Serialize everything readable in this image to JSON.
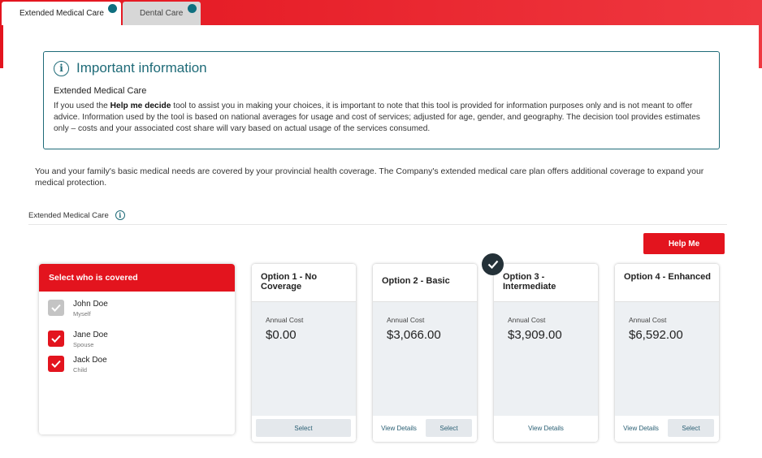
{
  "tabs": [
    {
      "label": "Extended Medical Care"
    },
    {
      "label": "Dental Care"
    }
  ],
  "info": {
    "heading": "Important information",
    "subheading": "Extended Medical Care",
    "body_pre": "If you used the ",
    "body_bold": "Help me decide",
    "body_post": " tool to assist you in making your choices, it is important to note that this tool is provided for information purposes only and is not meant to offer advice. Information used by the tool is based on national averages for usage and cost of services; adjusted for age, gender, and geography. The decision tool provides estimates only – costs and your associated cost share will vary based on actual usage of the services consumed."
  },
  "intro": "You and your family's basic medical needs are covered by your provincial health coverage. The Company's extended medical care plan offers additional coverage to expand your medical protection.",
  "section_label": "Extended Medical Care",
  "help_button": "Help Me",
  "covered": {
    "header": "Select who is covered",
    "members": [
      {
        "name": "John Doe",
        "relation": "Myself",
        "checked": true,
        "disabled": true
      },
      {
        "name": "Jane Doe",
        "relation": "Spouse",
        "checked": true,
        "disabled": false
      },
      {
        "name": "Jack Doe",
        "relation": "Child",
        "checked": true,
        "disabled": false
      }
    ]
  },
  "options": [
    {
      "title": "Option 1 - No Coverage",
      "cost_label": "Annual Cost",
      "cost": "$0.00",
      "view_details": "",
      "select": "Select",
      "selected": false
    },
    {
      "title": "Option 2 - Basic",
      "cost_label": "Annual Cost",
      "cost": "$3,066.00",
      "view_details": "View Details",
      "select": "Select",
      "selected": false
    },
    {
      "title": "Option 3 - Intermediate",
      "cost_label": "Annual Cost",
      "cost": "$3,909.00",
      "view_details": "View Details",
      "select": "",
      "selected": true
    },
    {
      "title": "Option 4 - Enhanced",
      "cost_label": "Annual Cost",
      "cost": "$6,592.00",
      "view_details": "View Details",
      "select": "Select",
      "selected": false
    }
  ],
  "colors": {
    "brand_red": "#e3141e",
    "teal": "#1f6b78",
    "check_dark": "#243138"
  },
  "icons": {
    "info": "info-circle-icon",
    "check": "check-icon",
    "tab_dot": "notification-dot-icon"
  }
}
